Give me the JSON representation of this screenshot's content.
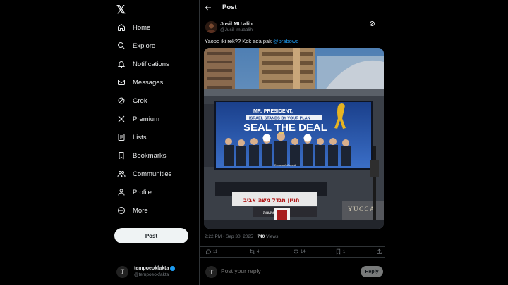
{
  "sidebar": {
    "logo": "𝕏",
    "items": [
      {
        "label": "Home",
        "icon": "home-icon"
      },
      {
        "label": "Explore",
        "icon": "search-icon"
      },
      {
        "label": "Notifications",
        "icon": "bell-icon"
      },
      {
        "label": "Messages",
        "icon": "envelope-icon"
      },
      {
        "label": "Grok",
        "icon": "grok-icon"
      },
      {
        "label": "Premium",
        "icon": "x-icon"
      },
      {
        "label": "Lists",
        "icon": "list-icon"
      },
      {
        "label": "Bookmarks",
        "icon": "bookmark-icon"
      },
      {
        "label": "Communities",
        "icon": "people-icon"
      },
      {
        "label": "Profile",
        "icon": "person-icon"
      },
      {
        "label": "More",
        "icon": "more-circle-icon"
      }
    ],
    "post_button": "Post",
    "account": {
      "avatar_letter": "T",
      "name": "tempoeokfakta",
      "handle": "@tempoeokfakta"
    }
  },
  "header": {
    "title": "Post"
  },
  "tweet": {
    "author_name": "Jusil MU.alih",
    "author_handle": "@Jusil_muaalih",
    "text": "Yaopo iki rek?? Kok ada pak ",
    "mention": "@prabowo",
    "billboard": {
      "line1": "MR. PRESIDENT,",
      "line2": "ISRAEL STANDS BY YOUR PLAN",
      "headline": "SEAL THE DEAL",
      "url": "ExmanaMiaSummit",
      "shop_sign": "חניון מגדל משה אביב",
      "shop_sign2": "מגדל שמשות",
      "brand": "YUCCA"
    },
    "time": "2:22 PM · Sep 30, 2025 · ",
    "views_count": "740",
    "views_label": " Views",
    "replies": "11",
    "reposts": "4",
    "likes": "14",
    "bookmarks": "1"
  },
  "reply": {
    "avatar_letter": "T",
    "placeholder": "Post your reply",
    "button": "Reply"
  },
  "colors": {
    "accent": "#1d9bf0",
    "background": "#000000",
    "text": "#e7e9ea",
    "muted": "#71767b"
  }
}
